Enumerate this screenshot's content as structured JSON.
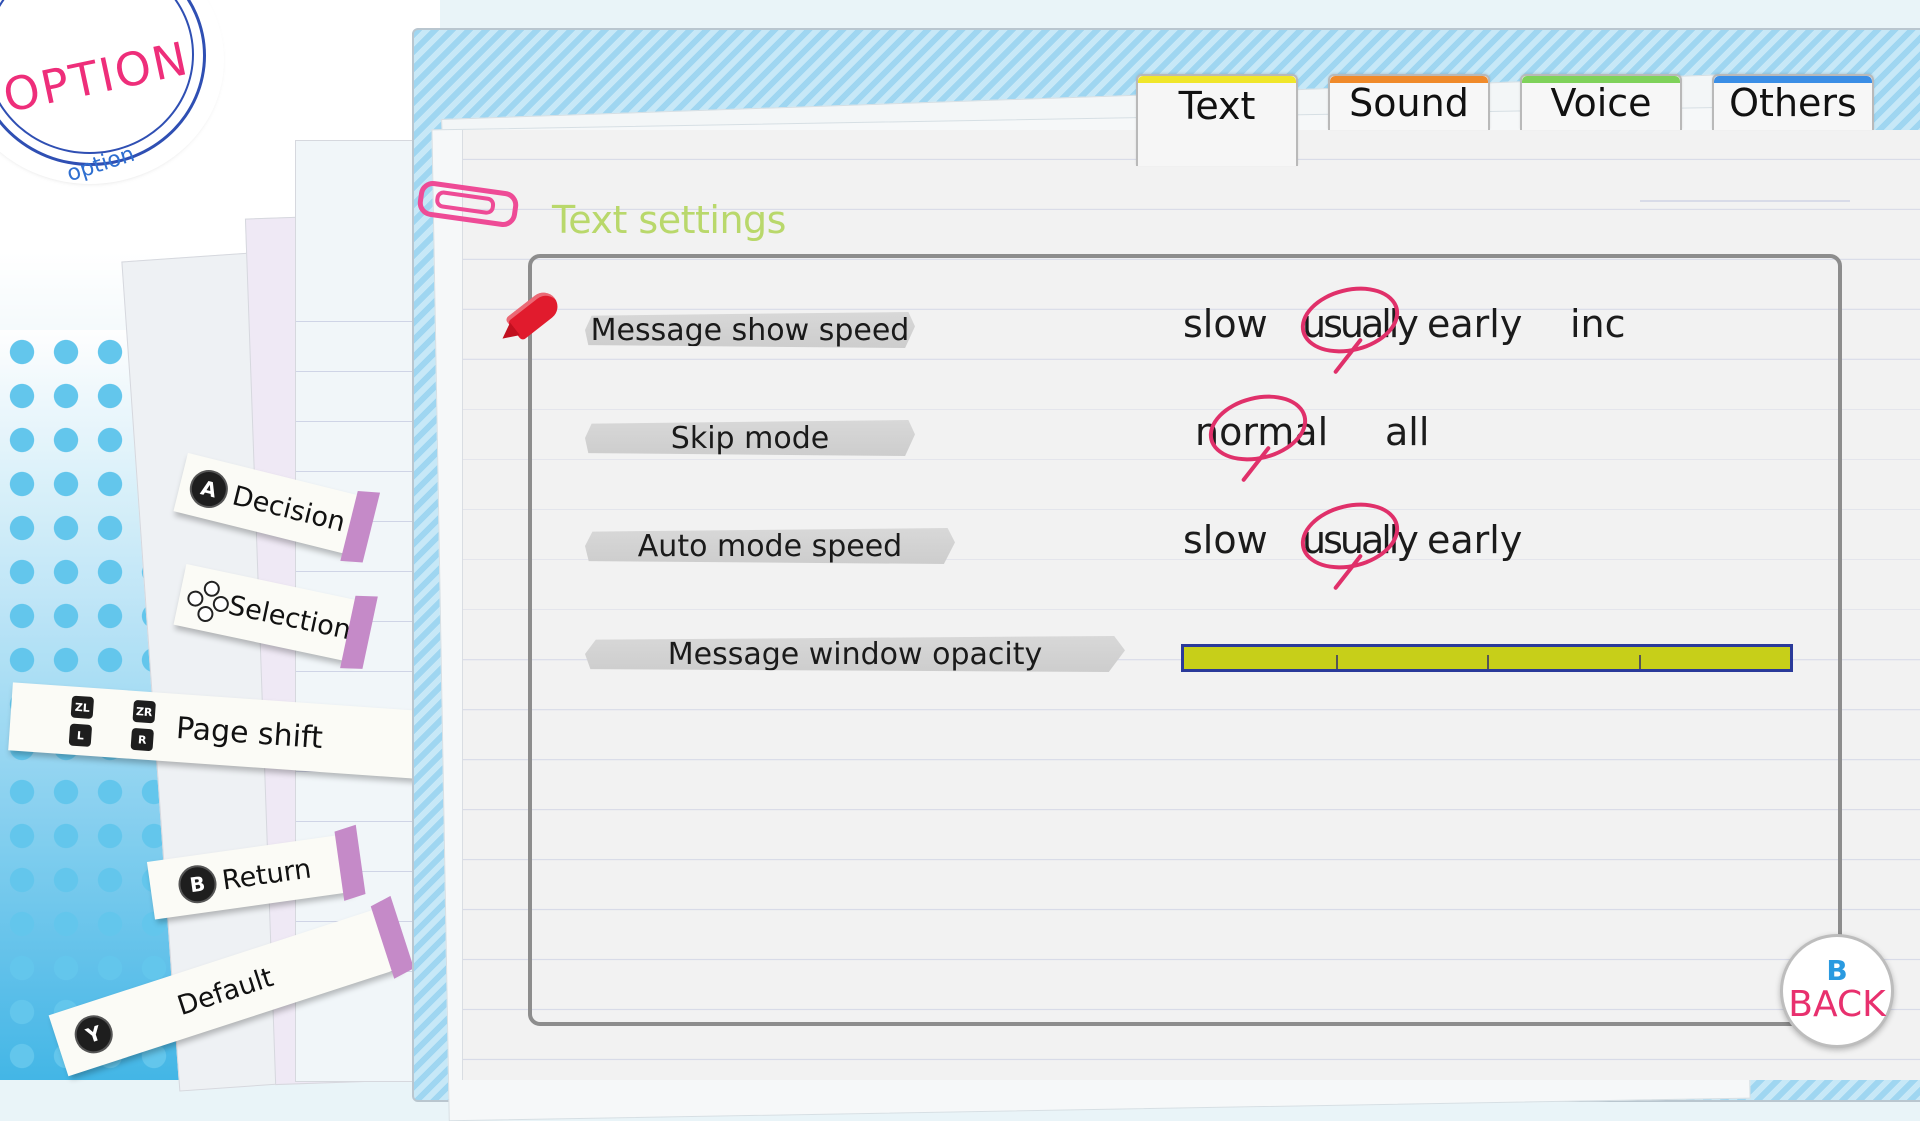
{
  "header": {
    "badge_title": "OPTION",
    "badge_sub": "option"
  },
  "tabs": [
    {
      "label": "Text",
      "stripe_color": "#f0e62a",
      "active": true
    },
    {
      "label": "Sound",
      "stripe_color": "#f08a2a",
      "active": false
    },
    {
      "label": "Voice",
      "stripe_color": "#7fd25a",
      "active": false
    },
    {
      "label": "Others",
      "stripe_color": "#3a8ee6",
      "active": false
    }
  ],
  "section_title": "Text settings",
  "settings": {
    "message_show_speed": {
      "label": "Message show speed",
      "options": [
        "slow",
        "usually",
        "early",
        "inc"
      ],
      "selected": "usually"
    },
    "skip_mode": {
      "label": "Skip mode",
      "options": [
        "normal",
        "all"
      ],
      "selected": "normal"
    },
    "auto_mode_speed": {
      "label": "Auto mode speed",
      "options": [
        "slow",
        "usually",
        "early"
      ],
      "selected": "usually"
    },
    "message_window_opacity": {
      "label": "Message window opacity",
      "value": 1.0
    }
  },
  "controls": {
    "decision": {
      "button": "A",
      "label": "Decision"
    },
    "selection": {
      "label": "Selection"
    },
    "page_shift": {
      "keys": [
        "ZL",
        "ZR",
        "L",
        "R"
      ],
      "label": "Page shift"
    },
    "return": {
      "button": "B",
      "label": "Return"
    },
    "default": {
      "button": "Y",
      "label": "Default"
    }
  },
  "back_button": {
    "button": "B",
    "label": "BACK"
  },
  "colors": {
    "accent_pink": "#e0306a",
    "title_green": "#b9d86b",
    "opacity_fill": "#c7cf19",
    "opacity_border": "#2a3a9a"
  }
}
